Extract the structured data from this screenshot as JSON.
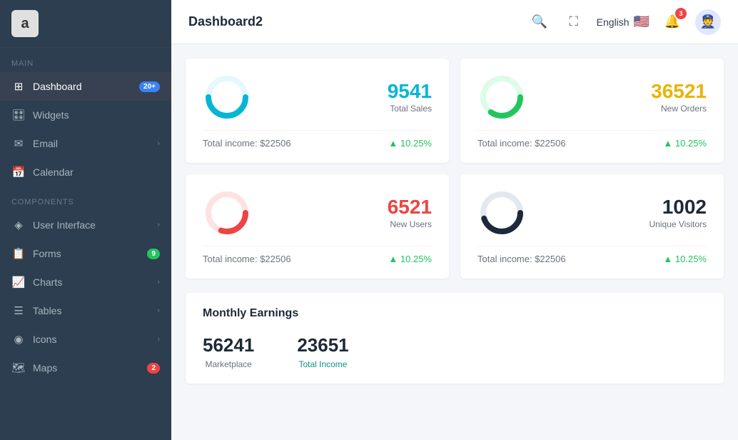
{
  "sidebar": {
    "logo_letter": "a",
    "main_label": "Main",
    "components_label": "Components",
    "items_main": [
      {
        "id": "dashboard",
        "label": "Dashboard",
        "icon": "⊞",
        "badge": "20+",
        "badge_type": "blue",
        "active": true
      },
      {
        "id": "widgets",
        "label": "Widgets",
        "icon": "🎛",
        "badge": null,
        "chevron": false
      },
      {
        "id": "email",
        "label": "Email",
        "icon": "✉",
        "badge": null,
        "chevron": true
      },
      {
        "id": "calendar",
        "label": "Calendar",
        "icon": "📅",
        "badge": null,
        "chevron": false
      }
    ],
    "items_components": [
      {
        "id": "user-interface",
        "label": "User Interface",
        "icon": "◈",
        "badge": null,
        "chevron": true
      },
      {
        "id": "forms",
        "label": "Forms",
        "icon": "📋",
        "badge": "9",
        "badge_type": "green",
        "chevron": false
      },
      {
        "id": "charts",
        "label": "Charts",
        "icon": "📈",
        "badge": null,
        "chevron": true
      },
      {
        "id": "tables",
        "label": "Tables",
        "icon": "☰",
        "badge": null,
        "chevron": true
      },
      {
        "id": "icons",
        "label": "Icons",
        "icon": "◉",
        "badge": null,
        "chevron": true
      },
      {
        "id": "maps",
        "label": "Maps",
        "icon": "🗺",
        "badge": "2",
        "badge_type": "red",
        "chevron": false
      }
    ]
  },
  "topbar": {
    "title": "Dashboard2",
    "language": "English",
    "notification_count": "3"
  },
  "cards": [
    {
      "id": "total-sales",
      "number": "9541",
      "label": "Total Sales",
      "number_color": "#06b6d4",
      "income": "Total income: $22506",
      "trend": "▲ 10.25%",
      "donut_color": "#06b6d4",
      "donut_bg": "#e5f9fd",
      "donut_pct": 75
    },
    {
      "id": "new-orders",
      "number": "36521",
      "label": "New Orders",
      "number_color": "#eab308",
      "income": "Total income: $22506",
      "trend": "▲ 10.25%",
      "donut_color": "#22c55e",
      "donut_bg": "#dcfce7",
      "donut_pct": 60
    },
    {
      "id": "new-users",
      "number": "6521",
      "label": "New Users",
      "number_color": "#ef4444",
      "income": "Total income: $22506",
      "trend": "▲ 10.25%",
      "donut_color": "#ef4444",
      "donut_bg": "#fee2e2",
      "donut_pct": 55
    },
    {
      "id": "unique-visitors",
      "number": "1002",
      "label": "Unique Visitors",
      "number_color": "#1e293b",
      "income": "Total income: $22506",
      "trend": "▲ 10.25%",
      "donut_color": "#1e293b",
      "donut_bg": "#e2e8f0",
      "donut_pct": 70
    }
  ],
  "monthly": {
    "title": "Monthly Earnings",
    "stats": [
      {
        "number": "56241",
        "label": "Marketplace"
      },
      {
        "number": "23651",
        "label": "Total Income",
        "label_color": "#0d9488"
      }
    ]
  }
}
